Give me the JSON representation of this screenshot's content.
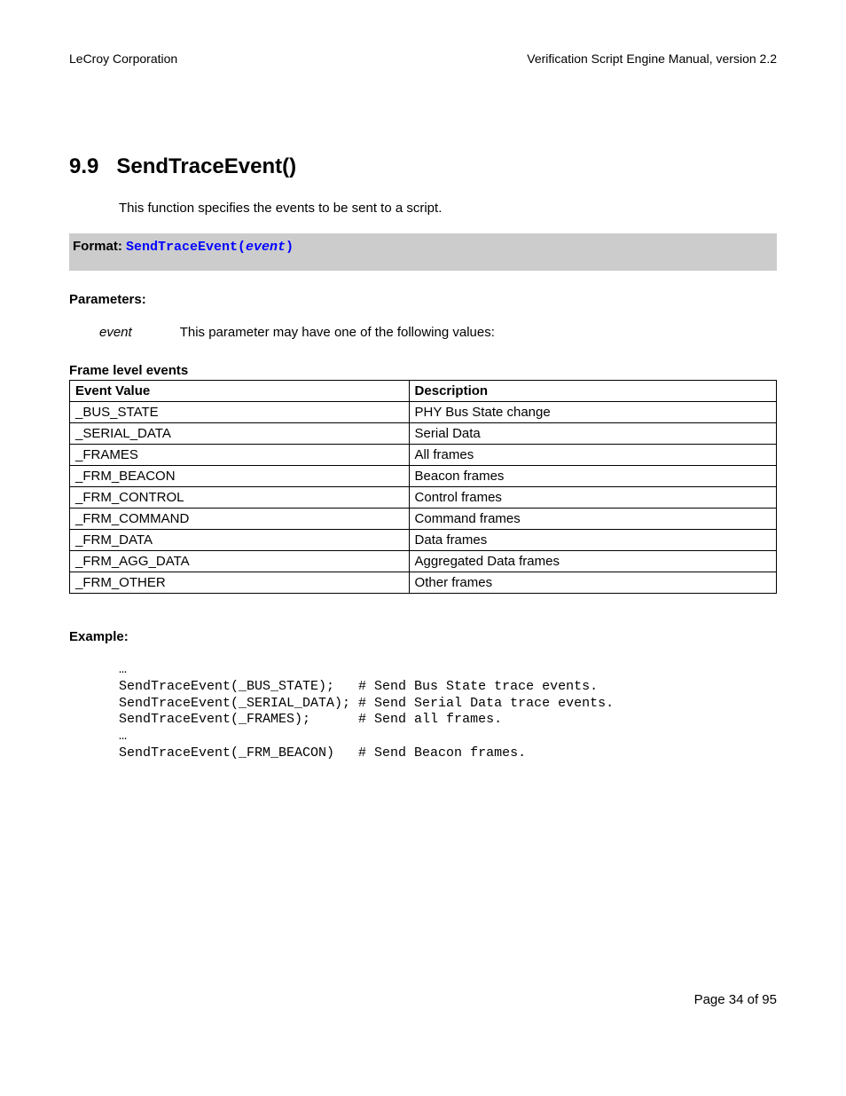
{
  "header": {
    "left": "LeCroy Corporation",
    "right": "Verification Script Engine Manual, version 2.2"
  },
  "section": {
    "number": "9.9",
    "title": "SendTraceEvent()",
    "intro": "This function specifies the events to be sent to a script."
  },
  "format": {
    "label": "Format: ",
    "func_open": "SendTraceEvent(",
    "arg": "event",
    "func_close": ")"
  },
  "parameters": {
    "label": "Parameters:",
    "name": "event",
    "desc": "This parameter may have one of the following values:"
  },
  "table": {
    "caption": "Frame level events",
    "headers": {
      "c1": "Event Value",
      "c2": "Description"
    },
    "rows": [
      {
        "c1": "_BUS_STATE",
        "c2": "PHY Bus State change"
      },
      {
        "c1": "_SERIAL_DATA",
        "c2": "Serial Data"
      },
      {
        "c1": "_FRAMES",
        "c2": "All frames"
      },
      {
        "c1": "_FRM_BEACON",
        "c2": "Beacon frames"
      },
      {
        "c1": "_FRM_CONTROL",
        "c2": "Control frames"
      },
      {
        "c1": "_FRM_COMMAND",
        "c2": "Command frames"
      },
      {
        "c1": "_FRM_DATA",
        "c2": "Data frames"
      },
      {
        "c1": "_FRM_AGG_DATA",
        "c2": "Aggregated Data frames"
      },
      {
        "c1": "_FRM_OTHER",
        "c2": "Other frames"
      }
    ]
  },
  "example": {
    "label": "Example:",
    "code": "…\nSendTraceEvent(_BUS_STATE);   # Send Bus State trace events.\nSendTraceEvent(_SERIAL_DATA); # Send Serial Data trace events.\nSendTraceEvent(_FRAMES);      # Send all frames.\n…\nSendTraceEvent(_FRM_BEACON)   # Send Beacon frames."
  },
  "footer": {
    "page": "Page 34 of 95"
  }
}
